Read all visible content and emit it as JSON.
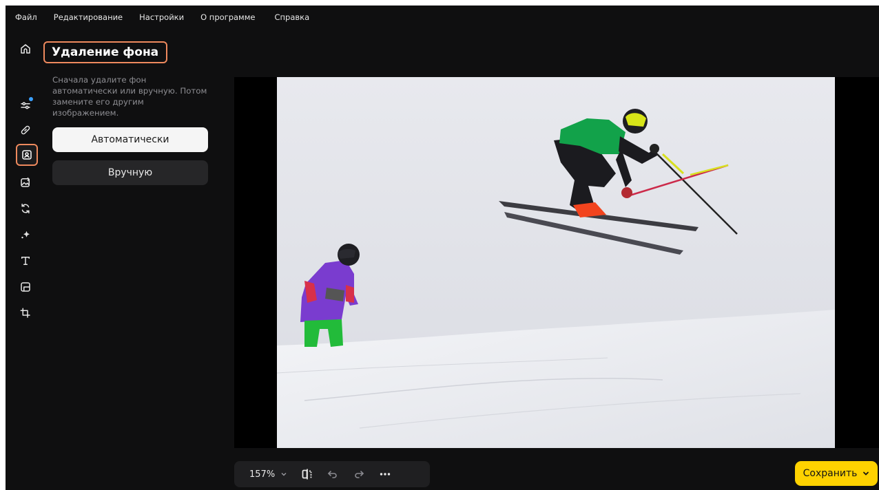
{
  "menu": {
    "file": "Файл",
    "edit": "Редактирование",
    "settings": "Настройки",
    "about": "О программе",
    "help": "Справка"
  },
  "rail": {
    "items": [
      {
        "icon": "home-icon"
      },
      {
        "icon": "adjustments-icon",
        "badge": true
      },
      {
        "icon": "retouch-bandage-icon"
      },
      {
        "icon": "background-removal-icon",
        "active": true
      },
      {
        "icon": "image-replace-icon"
      },
      {
        "icon": "transform-icon"
      },
      {
        "icon": "effects-sparkle-icon"
      },
      {
        "icon": "text-icon"
      },
      {
        "icon": "frame-icon"
      },
      {
        "icon": "crop-icon"
      }
    ]
  },
  "panel": {
    "title": "Удаление фона",
    "description": "Сначала удалите фон автоматически или вручную. Потом замените его другим изображением.",
    "auto_label": "Автоматически",
    "manual_label": "Вручную"
  },
  "toolbar": {
    "zoom": "157%"
  },
  "save": {
    "label": "Сохранить"
  },
  "colors": {
    "accent_highlight": "#ef8a5e",
    "save_button": "#ffd200",
    "background": "#0f0f10",
    "badge": "#3aa0ff"
  }
}
